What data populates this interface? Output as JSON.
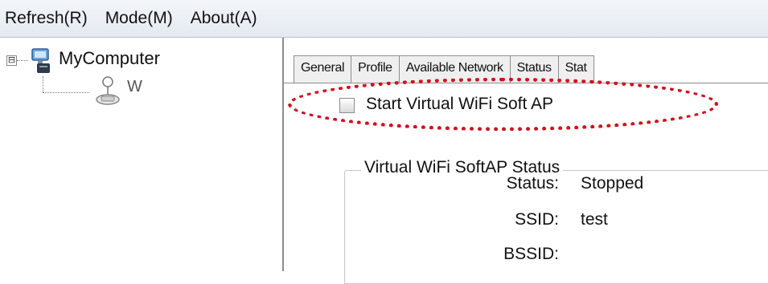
{
  "menubar": {
    "items": [
      "Refresh(R)",
      "Mode(M)",
      "About(A)"
    ]
  },
  "tree": {
    "root_label": "MyComputer",
    "child_label": "W",
    "expander": "⊟"
  },
  "tabs": [
    "General",
    "Profile",
    "Available Network",
    "Status",
    "Stat"
  ],
  "softap": {
    "checkbox_label": "Start Virtual WiFi Soft AP",
    "checked": false,
    "group_title": "Virtual WiFi SoftAP Status",
    "fields": [
      {
        "label": "Status:",
        "value": "Stopped"
      },
      {
        "label": "SSID:",
        "value": "test"
      },
      {
        "label": "BSSID:",
        "value": ""
      }
    ]
  },
  "colors": {
    "highlight": "#d0101c",
    "menubar": "#e4e9f1"
  }
}
